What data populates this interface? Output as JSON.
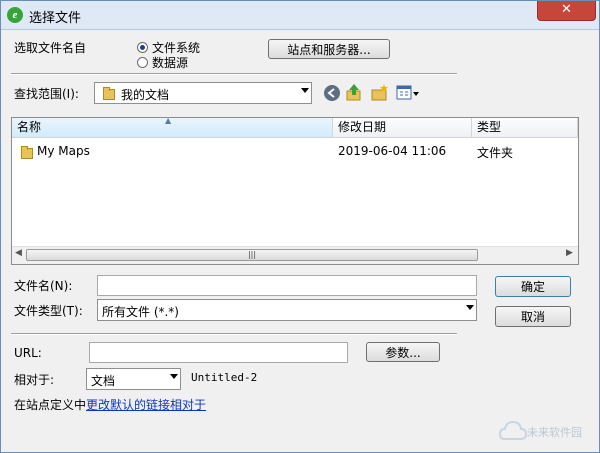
{
  "window": {
    "title": "选择文件",
    "close_glyph": "✕",
    "app_icon_glyph": "e"
  },
  "source": {
    "label": "选取文件名自",
    "options": [
      {
        "label": "文件系统",
        "checked": true
      },
      {
        "label": "数据源",
        "checked": false
      }
    ],
    "sites_button": "站点和服务器..."
  },
  "lookin": {
    "label": "查找范围(I):",
    "value": "我的文档"
  },
  "toolbar": {
    "icons": [
      "back-icon",
      "up-folder-icon",
      "new-folder-icon",
      "view-menu-icon"
    ]
  },
  "filelist": {
    "columns": [
      "名称",
      "修改日期",
      "类型"
    ],
    "rows": [
      {
        "name": "My Maps",
        "modified": "2019-06-04 11:06",
        "type": "文件夹"
      }
    ],
    "scroll_grip": "|||"
  },
  "filename": {
    "label": "文件名(N):",
    "value": ""
  },
  "filetype": {
    "label": "文件类型(T):",
    "value": "所有文件 (*.*)"
  },
  "buttons": {
    "ok": "确定",
    "cancel": "取消",
    "params": "参数..."
  },
  "url": {
    "label": "URL:",
    "value": ""
  },
  "relative": {
    "label": "相对于:",
    "value": "文档",
    "doc_name": "Untitled-2"
  },
  "site_def": {
    "prefix": "在站点定义中",
    "link": "更改默认的链接相对于"
  },
  "watermark": "未来软件园"
}
